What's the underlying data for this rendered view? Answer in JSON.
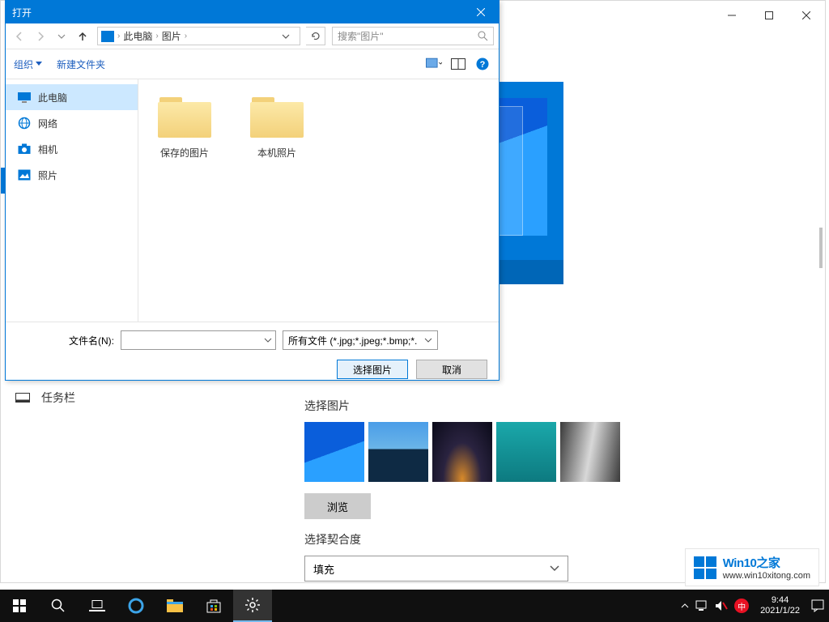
{
  "background_window": {
    "left_panel": {
      "taskbar_label": "任务栏"
    },
    "right_panel": {
      "select_picture_label": "选择图片",
      "browse_label": "浏览",
      "fit_label": "选择契合度",
      "fit_value": "填充"
    }
  },
  "dialog": {
    "title": "打开",
    "breadcrumb": {
      "pc": "此电脑",
      "pics": "图片"
    },
    "search_placeholder": "搜索\"图片\"",
    "toolbar": {
      "organize": "组织",
      "new_folder": "新建文件夹"
    },
    "sidebar": [
      {
        "label": "此电脑",
        "icon": "pc"
      },
      {
        "label": "网络",
        "icon": "network"
      },
      {
        "label": "相机",
        "icon": "camera"
      },
      {
        "label": "照片",
        "icon": "photos"
      }
    ],
    "folders": [
      {
        "name": "保存的图片"
      },
      {
        "name": "本机照片"
      }
    ],
    "filename_label": "文件名(N):",
    "filter": "所有文件 (*.jpg;*.jpeg;*.bmp;*.",
    "open_btn": "选择图片",
    "cancel_btn": "取消"
  },
  "taskbar": {
    "time": "9:44",
    "date": "2021/1/22"
  },
  "watermark": {
    "brand": "Win10之家",
    "url": "www.win10xitong.com"
  }
}
